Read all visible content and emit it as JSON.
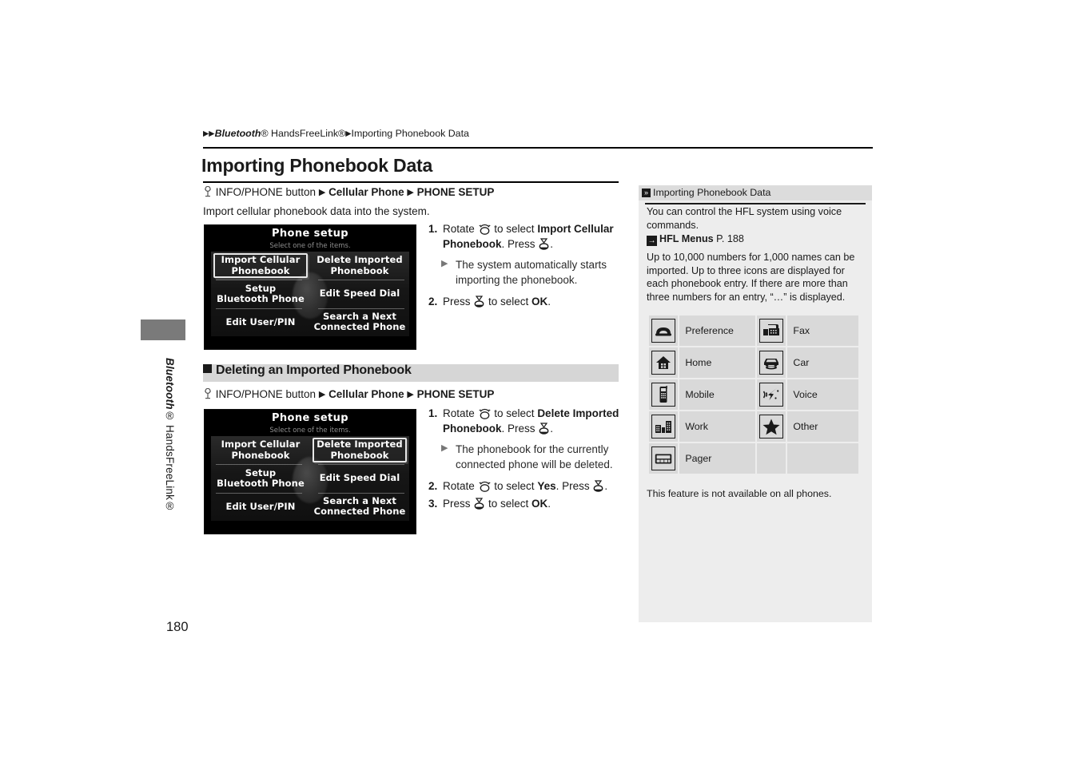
{
  "breadcrumb": {
    "prefix_arrows": "▶▶",
    "part1": "Bluetooth",
    "part1_reg": "®",
    "part2": " HandsFreeLink®",
    "arrow": "▶",
    "part3": "Importing Phonebook Data"
  },
  "page_title": "Importing Phonebook Data",
  "nav_path_1": {
    "button": "INFO/PHONE button",
    "step1": "Cellular Phone",
    "step2": "PHONE SETUP"
  },
  "nav_path_2": {
    "button": "INFO/PHONE button",
    "step1": "Cellular Phone",
    "step2": "PHONE SETUP"
  },
  "lead_text": "Import cellular phonebook data into the system.",
  "section2_heading": "Deleting an Imported Phonebook",
  "screen1": {
    "title": "Phone setup",
    "subtitle": "Select one of the items.",
    "items": [
      "Import Cellular\nPhonebook",
      "Delete Imported\nPhonebook",
      "Setup\nBluetooth Phone",
      "Edit Speed Dial",
      "Edit User/PIN",
      "Search a Next\nConnected Phone"
    ],
    "selected_index": 0
  },
  "screen2": {
    "title": "Phone setup",
    "subtitle": "Select one of the items.",
    "items": [
      "Import Cellular\nPhonebook",
      "Delete Imported\nPhonebook",
      "Setup\nBluetooth Phone",
      "Edit Speed Dial",
      "Edit User/PIN",
      "Search a Next\nConnected Phone"
    ],
    "selected_index": 1
  },
  "steps1": [
    {
      "num": "1.",
      "pre": "Rotate ",
      "mid": " to select ",
      "bold": "Import Cellular Phonebook",
      "post": ". Press ",
      "end": "."
    },
    {
      "num": "2.",
      "pre": "Press ",
      "mid": " to select ",
      "bold": "OK",
      "post": ".",
      "end": ""
    }
  ],
  "steps1_sub": "The system automatically starts importing the phonebook.",
  "steps2": [
    {
      "num": "1.",
      "pre": "Rotate ",
      "mid": " to select ",
      "bold": "Delete Imported Phonebook",
      "post": ". Press ",
      "end": "."
    },
    {
      "num": "2.",
      "pre": "Rotate ",
      "mid": " to select ",
      "bold": "Yes",
      "post": ". Press ",
      "end": "."
    },
    {
      "num": "3.",
      "pre": "Press ",
      "mid": " to select ",
      "bold": "OK",
      "post": ".",
      "end": ""
    }
  ],
  "steps2_sub": "The phonebook for the currently connected phone will be deleted.",
  "aside": {
    "header": "Importing Phonebook Data",
    "para1": "You can control the HFL system using voice commands.",
    "ref_label": "HFL Menus",
    "ref_page": "P. 188",
    "para2": "Up to 10,000 numbers for 1,000 names can be imported. Up to three icons are displayed for each phonebook entry. If there are more than three numbers for an entry, “…” is displayed.",
    "icon_rows": [
      {
        "left": {
          "icon": "telephone-handset-icon",
          "label": "Preference"
        },
        "right": {
          "icon": "fax-machine-icon",
          "label": "Fax"
        }
      },
      {
        "left": {
          "icon": "house-icon",
          "label": "Home"
        },
        "right": {
          "icon": "car-phone-icon",
          "label": "Car"
        }
      },
      {
        "left": {
          "icon": "mobile-phone-icon",
          "label": "Mobile"
        },
        "right": {
          "icon": "voice-waves-icon",
          "label": "Voice"
        }
      },
      {
        "left": {
          "icon": "office-buildings-icon",
          "label": "Work"
        },
        "right": {
          "icon": "star-icon",
          "label": "Other"
        }
      },
      {
        "left": {
          "icon": "pager-icon",
          "label": "Pager"
        },
        "right": {
          "icon": "",
          "label": ""
        }
      }
    ],
    "note": "This feature is not available on all phones."
  },
  "side_label_part1": "Bluetooth",
  "side_label_part2": "® HandsFreeLink®",
  "page_number": "180"
}
